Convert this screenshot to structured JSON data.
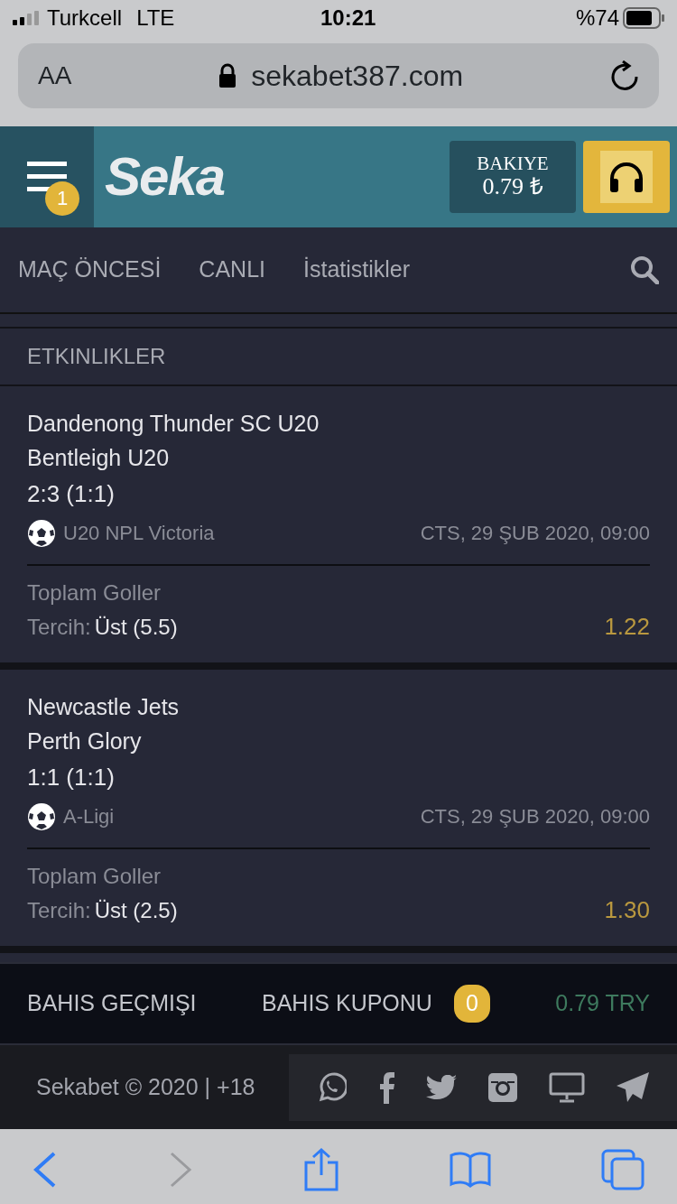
{
  "status_bar": {
    "carrier": "Turkcell",
    "network": "LTE",
    "time": "10:21",
    "battery": "%74"
  },
  "browser": {
    "text_size": "AA",
    "url": "sekabet387.com"
  },
  "header": {
    "menu_badge": "1",
    "logo": "Seka",
    "balance_label": "BAKIYE",
    "balance": "0.79 ₺"
  },
  "nav": {
    "tabs": [
      {
        "label": "MAÇ ÖNCESİ"
      },
      {
        "label": "CANLI"
      },
      {
        "label": "İstatistikler"
      }
    ]
  },
  "section_title": "ETKINLIKLER",
  "events": [
    {
      "home": "Dandenong Thunder SC U20",
      "away": "Bentleigh U20",
      "score": "2:3 (1:1)",
      "league": "U20 NPL Victoria",
      "date": "CTS, 29 ŞUB 2020, 09:00",
      "market": "Toplam Goller",
      "pick_label": "Tercih:",
      "pick": "Üst (5.5)",
      "odds": "1.22"
    },
    {
      "home": "Newcastle Jets",
      "away": "Perth Glory",
      "score": "1:1 (1:1)",
      "league": "A-Ligi",
      "date": "CTS, 29 ŞUB 2020, 09:00",
      "market": "Toplam Goller",
      "pick_label": "Tercih:",
      "pick": "Üst (2.5)",
      "odds": "1.30"
    }
  ],
  "bottom_bar": {
    "history": "BAHIS GEÇMIŞI",
    "coupon": "BAHIS KUPONU",
    "coupon_count": "0",
    "balance": "0.79 TRY"
  },
  "footer": {
    "copyright": "Sekabet © 2020 | +18"
  }
}
